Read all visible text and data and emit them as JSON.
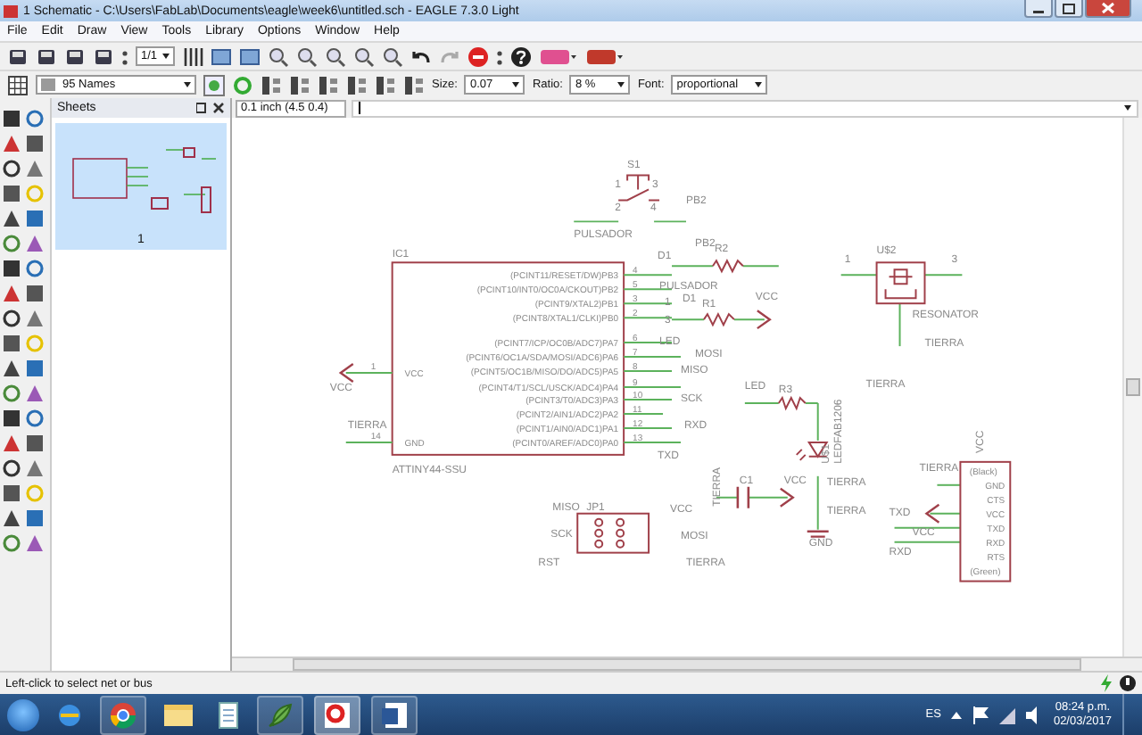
{
  "window": {
    "title": "1 Schematic - C:\\Users\\FabLab\\Documents\\eagle\\week6\\untitled.sch - EAGLE 7.3.0 Light"
  },
  "menu": [
    "File",
    "Edit",
    "Draw",
    "View",
    "Tools",
    "Library",
    "Options",
    "Window",
    "Help"
  ],
  "toolbar": {
    "sheet_select": "1/1"
  },
  "layer_bar": {
    "layer": "95 Names",
    "size_label": "Size:",
    "size": "0.07",
    "ratio_label": "Ratio:",
    "ratio": "8 %",
    "font_label": "Font:",
    "font": "proportional"
  },
  "coordinates": "0.1 inch (4.5 0.4)",
  "sheets_panel": {
    "title": "Sheets",
    "sheets": [
      {
        "label": "1",
        "selected": true
      }
    ]
  },
  "schematic": {
    "ic": {
      "name": "IC1",
      "value": "ATTINY44-SSU",
      "pins": [
        {
          "label": "(PCINT11/RESET/DW)PB3",
          "number": "4"
        },
        {
          "label": "(PCINT10/INT0/OC0A/CKOUT)PB2",
          "number": "5"
        },
        {
          "label": "(PCINT9/XTAL2)PB1",
          "number": "3"
        },
        {
          "label": "(PCINT8/XTAL1/CLKI)PB0",
          "number": "2"
        },
        {
          "label": "(PCINT7/ICP/OC0B/ADC7)PA7",
          "number": "6"
        },
        {
          "label": "(PCINT6/OC1A/SDA/MOSI/ADC6)PA6",
          "number": "7"
        },
        {
          "label": "(PCINT5/OC1B/MISO/DO/ADC5)PA5",
          "number": "8"
        },
        {
          "label": "(PCINT4/T1/SCL/USCK/ADC4)PA4",
          "number": "9"
        },
        {
          "label": "(PCINT3/T0/ADC3)PA3",
          "number": "10"
        },
        {
          "label": "(PCINT2/AIN1/ADC2)PA2",
          "number": "11"
        },
        {
          "label": "(PCINT1/AIN0/ADC1)PA1",
          "number": "12"
        },
        {
          "label": "(PCINT0/AREF/ADC0)PA0",
          "number": "13"
        }
      ],
      "power_pins": [
        {
          "label": "VCC",
          "number": "1"
        },
        {
          "label": "GND",
          "number": "14"
        }
      ]
    },
    "connector": {
      "top": "(Black)",
      "bottom": "(Green)",
      "pins": [
        "GND",
        "CTS",
        "VCC",
        "TXD",
        "RXD",
        "RTS"
      ]
    },
    "labels": [
      "S1",
      "1",
      "3",
      "2",
      "4",
      "PB2",
      "PULSADOR",
      "D1",
      "PB2",
      "R2",
      "PULSADOR",
      "D1",
      "R1",
      "VCC",
      "1",
      "3",
      "LED",
      "MOSI",
      "MISO",
      "SCK",
      "RXD",
      "TXD",
      "VCC",
      "TIERRA",
      "U$2",
      "1",
      "3",
      "RESONATOR",
      "TIERRA",
      "LED",
      "TIERRA",
      "R3",
      "LEDFAB1206",
      "U$1",
      "C1",
      "VCC",
      "TIERRA",
      "TIERRA",
      "TIERRA",
      "GND",
      "VCC",
      "TIERRA",
      "TXD",
      "VCC",
      "RXD",
      "MISO",
      "JP1",
      "VCC",
      "SCK",
      "MOSI",
      "RST",
      "TIERRA"
    ]
  },
  "status": "Left-click to select net or bus",
  "taskbar": {
    "language": "ES",
    "time": "08:24 p.m.",
    "date": "02/03/2017"
  }
}
